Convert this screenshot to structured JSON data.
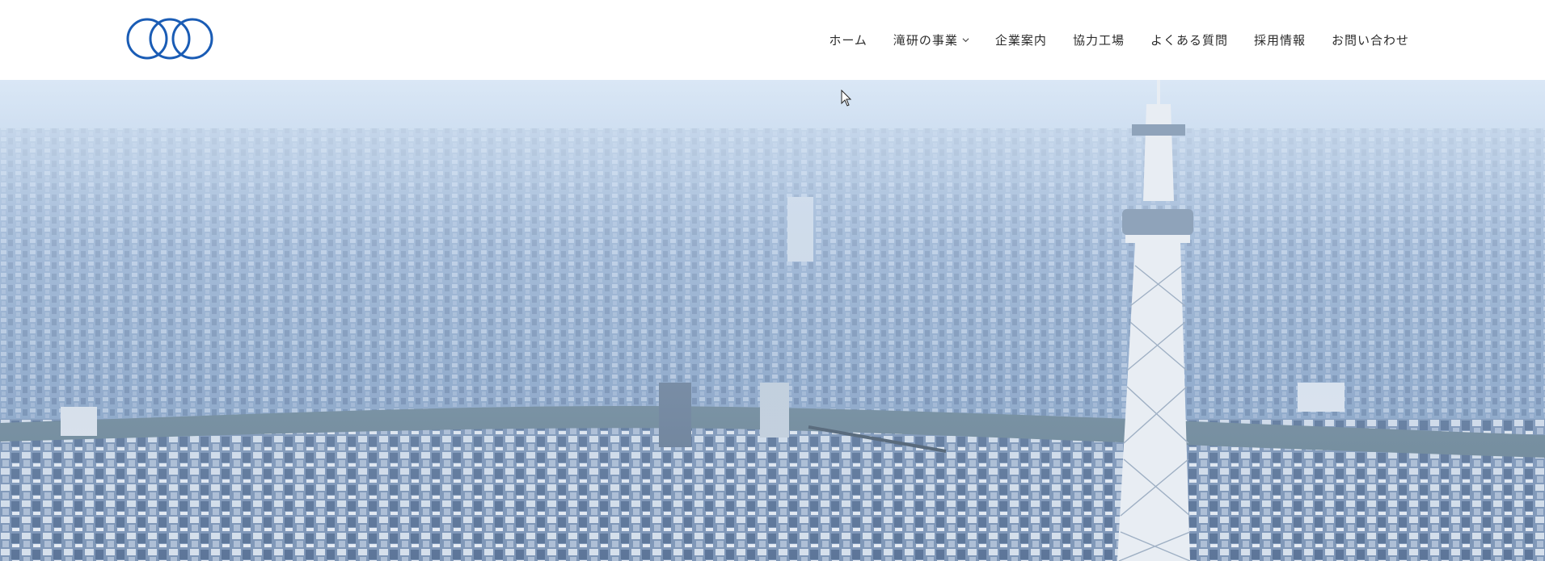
{
  "header": {
    "logo_icon": "interlocking-rings-logo-icon",
    "brand_color": "#1a5cb5",
    "nav": [
      {
        "label": "ホーム",
        "has_dropdown": false
      },
      {
        "label": "滝研の事業",
        "has_dropdown": true
      },
      {
        "label": "企業案内",
        "has_dropdown": false
      },
      {
        "label": "協力工場",
        "has_dropdown": false
      },
      {
        "label": "よくある質問",
        "has_dropdown": false
      },
      {
        "label": "採用情報",
        "has_dropdown": false
      },
      {
        "label": "お問い合わせ",
        "has_dropdown": false
      }
    ]
  },
  "hero": {
    "image": "aerial-tokyo-skytree-cityscape",
    "sky_color": "#cfe0f3",
    "city_color": "#8aa6c8",
    "river_color": "#6f8898",
    "tower_color": "#e8edf3"
  },
  "cursor_icon": "mouse-pointer-icon"
}
